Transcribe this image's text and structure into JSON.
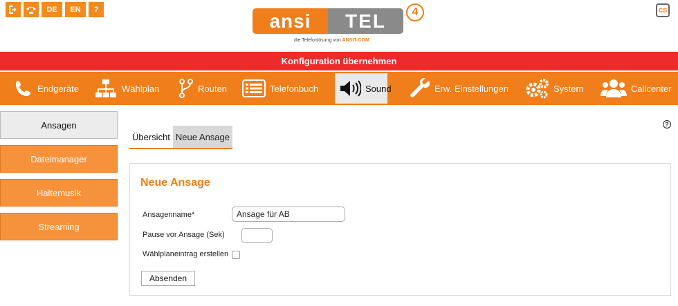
{
  "header": {
    "lang_de": "DE",
    "lang_en": "EN",
    "help_glyph": "?",
    "logo_left": "ansi",
    "logo_right": "TEL",
    "logo_version": "4",
    "logo_tagline_prefix": "die Telefonlösung von",
    "logo_tagline_brand": "ANSIT-COM",
    "cs_label": "CS"
  },
  "config_bar": {
    "label": "Konfiguration übernehmen",
    "color": "#ee2b2b"
  },
  "nav": {
    "accent": "#f07e1a",
    "items": [
      {
        "label": "Endgeräte",
        "icon": "phone-icon"
      },
      {
        "label": "Wählplan",
        "icon": "sitemap-icon"
      },
      {
        "label": "Routen",
        "icon": "route-icon"
      },
      {
        "label": "Telefonbuch",
        "icon": "list-icon"
      },
      {
        "label": "Sound",
        "icon": "speaker-icon",
        "active": true
      },
      {
        "label": "Erw. Einstellungen",
        "icon": "wrench-icon"
      },
      {
        "label": "System",
        "icon": "gears-icon"
      },
      {
        "label": "Callcenter",
        "icon": "users-icon"
      }
    ]
  },
  "sidebar": {
    "items": [
      {
        "label": "Ansagen",
        "active": true
      },
      {
        "label": "Dateimanager"
      },
      {
        "label": "Haltemusik"
      },
      {
        "label": "Streaming"
      }
    ]
  },
  "tabs": [
    {
      "label": "Übersicht"
    },
    {
      "label": "Neue Ansage",
      "active": true
    }
  ],
  "form": {
    "title": "Neue Ansage",
    "name_label": "Ansagenname*",
    "name_value": "Ansage für AB",
    "pause_label": "Pause vor Ansage (Sek)",
    "pause_value": "",
    "dialplan_label": "Wählplaneintrag erstellen",
    "dialplan_checked": false,
    "submit_label": "Absenden"
  },
  "help_glyph": "?"
}
